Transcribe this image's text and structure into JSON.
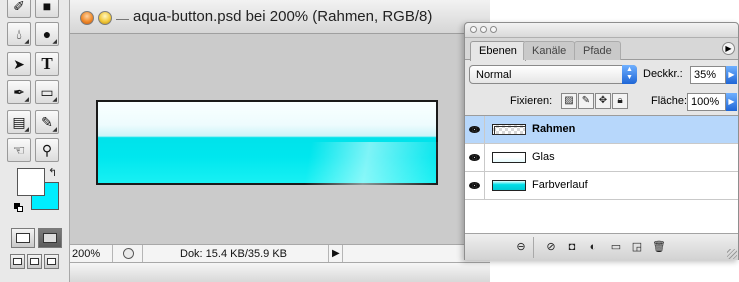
{
  "tools": {
    "icons": [
      "eraser-icon",
      "fill-icon",
      "dodge-icon",
      "blur-icon",
      "selection-arrow-icon",
      "type-tool-icon",
      "pen-icon",
      "rectangle-shape-icon",
      "notes-icon",
      "eyedropper-icon",
      "hand-icon",
      "zoom-icon"
    ],
    "type_tool_glyph": "T",
    "foreground_color": "#ffffff",
    "background_color": "#00eeff"
  },
  "document": {
    "title": "aqua-button.psd bei 200% (Rahmen, RGB/8)",
    "zoom": "200%",
    "doc_size": "Dok: 15.4 KB/35.9 KB",
    "canvas_colors": {
      "top": "#f9ffff",
      "bottom": "#00e7ee"
    }
  },
  "layers_palette": {
    "tabs": [
      {
        "label": "Ebenen",
        "active": true
      },
      {
        "label": "Kanäle",
        "active": false
      },
      {
        "label": "Pfade",
        "active": false
      }
    ],
    "blend_mode": "Normal",
    "opacity_label": "Deckkr.:",
    "opacity_value": "35%",
    "lock_label": "Fixieren:",
    "fill_label": "Fläche:",
    "fill_value": "100%",
    "layers": [
      {
        "name": "Rahmen",
        "selected": true,
        "bold": true,
        "visible": true
      },
      {
        "name": "Glas",
        "selected": false,
        "bold": false,
        "visible": true
      },
      {
        "name": "Farbverlauf",
        "selected": false,
        "bold": false,
        "visible": true
      }
    ],
    "selection_color": "#b7d7fb"
  }
}
